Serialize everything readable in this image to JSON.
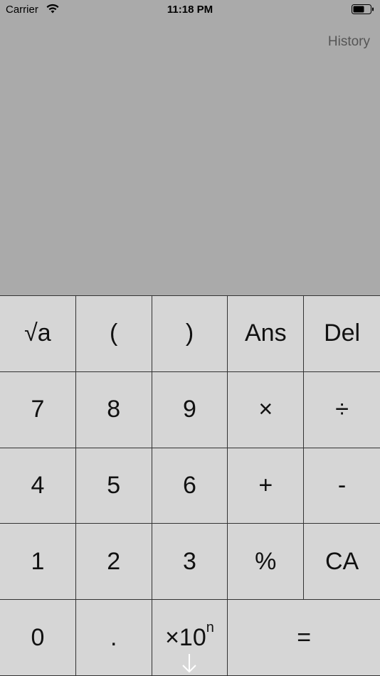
{
  "status_bar": {
    "carrier": "Carrier",
    "time": "11:18 PM",
    "wifi_icon": "wifi-icon",
    "battery_icon": "battery-icon"
  },
  "header": {
    "history_label": "History"
  },
  "keypad": {
    "rows": [
      [
        "√a",
        "(",
        ")",
        "Ans",
        "Del"
      ],
      [
        "7",
        "8",
        "9",
        "×",
        "÷"
      ],
      [
        "4",
        "5",
        "6",
        "+",
        "-"
      ],
      [
        "1",
        "2",
        "3",
        "%",
        "CA"
      ],
      [
        "0",
        ".",
        "×10",
        "="
      ]
    ],
    "exp_superscript": "n",
    "exp_arrow_icon": "arrow-down-icon"
  },
  "colors": {
    "display_bg": "#aaaaaa",
    "key_bg": "#d6d6d6",
    "key_border": "#333333",
    "history_text": "#555555"
  }
}
